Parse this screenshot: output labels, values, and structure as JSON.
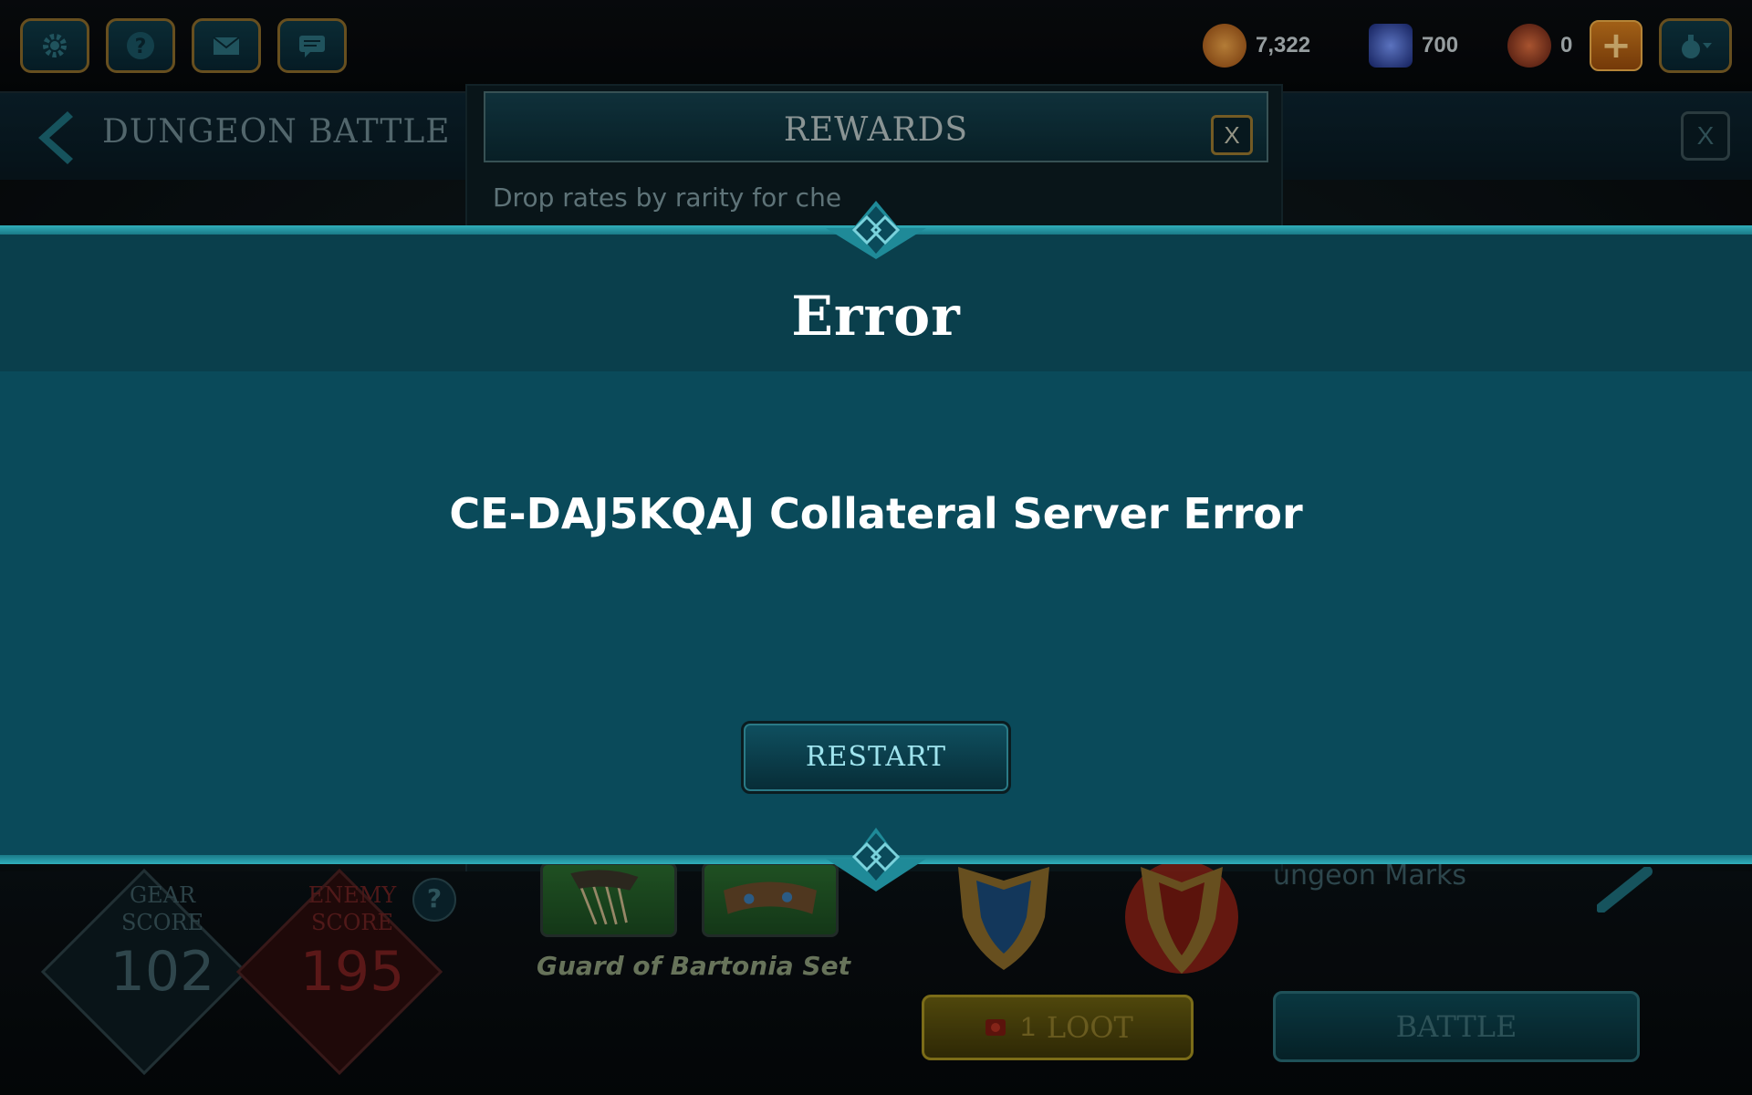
{
  "topbar": {
    "buttons": [
      {
        "icon": "gear-icon"
      },
      {
        "icon": "help-icon"
      },
      {
        "icon": "mail-icon"
      },
      {
        "icon": "chat-icon"
      }
    ],
    "currencies": [
      {
        "icon": "gold-coin-icon",
        "value": "7,322",
        "color": "#d98a2a"
      },
      {
        "icon": "gem-icon",
        "value": "700",
        "color": "#4a6ad0"
      },
      {
        "icon": "crown-icon",
        "value": "0",
        "color": "#d0542a"
      }
    ],
    "plus_label": "+"
  },
  "header": {
    "title": "DUNGEON BATTLE",
    "close_label": "X"
  },
  "rewards": {
    "title": "REWARDS",
    "close_label": "X",
    "drop_rates_text": "Drop rates by rarity for che"
  },
  "bottom": {
    "gear_score_label": "GEAR SCORE",
    "gear_score_value": "102",
    "enemy_score_label": "ENEMY SCORE",
    "enemy_score_value": "195",
    "help_label": "?",
    "set_name": "Guard of Bartonia Set",
    "dungeon_marks_text": "ungeon Marks",
    "loot_count": "1",
    "loot_label": "LOOT",
    "battle_label": "BATTLE"
  },
  "modal": {
    "title": "Error",
    "message": "CE-DAJ5KQAJ Collateral Server Error",
    "button_label": "RESTART"
  },
  "colors": {
    "modal_bg": "#0a4a5a",
    "modal_border": "#30aeba",
    "restart_text": "#9fe4ee"
  }
}
